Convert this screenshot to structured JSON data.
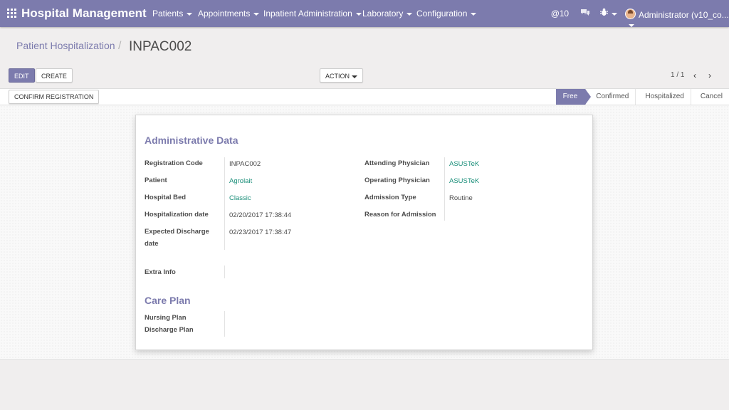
{
  "navbar": {
    "brand": "Hospital Management",
    "menus": [
      "Patients",
      "Appointments",
      "Inpatient Administration",
      "Laboratory",
      "Configuration"
    ],
    "mentions_count": "10",
    "user": "Administrator (v10_co..."
  },
  "breadcrumb": {
    "parent": "Patient Hospitalization",
    "current": "INPAC002"
  },
  "toolbar": {
    "edit_label": "EDIT",
    "create_label": "CREATE",
    "action_label": "ACTION",
    "pager": "1 / 1"
  },
  "statusbar": {
    "confirm_label": "CONFIRM REGISTRATION",
    "stages": [
      "Free",
      "Confirmed",
      "Hospitalized",
      "Cancel"
    ],
    "active_stage": "Free"
  },
  "form": {
    "admin_title": "Administrative Data",
    "left_fields": [
      {
        "label": "Registration Code",
        "value": "INPAC002"
      },
      {
        "label": "Patient",
        "value": "Agrolait"
      },
      {
        "label": "Hospital Bed",
        "value": "Classic"
      },
      {
        "label": "Hospitalization date",
        "value": "02/20/2017 17:38:44"
      },
      {
        "label": "Expected Discharge date",
        "value": "02/23/2017 17:38:47"
      }
    ],
    "right_fields": [
      {
        "label": "Attending Physician",
        "value": "ASUSTeK"
      },
      {
        "label": "Operating Physician",
        "value": "ASUSTeK"
      },
      {
        "label": "Admission Type",
        "value": "Routine"
      },
      {
        "label": "Reason for Admission",
        "value": ""
      }
    ],
    "extra_info_label": "Extra Info",
    "care_title": "Care Plan",
    "nursing_plan_label": "Nursing Plan",
    "discharge_plan_label": "Discharge Plan"
  },
  "colors": {
    "brand": "#7c7bad",
    "link": "#1b8f7a"
  }
}
